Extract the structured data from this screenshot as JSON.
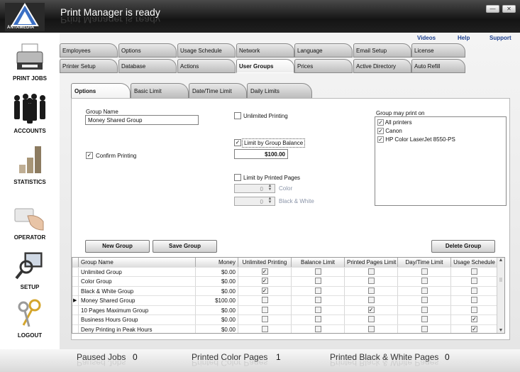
{
  "app": {
    "title": "Print Manager is ready",
    "logo_text": "ANTAMEDIA"
  },
  "window": {
    "minimize": "—",
    "close": "✕"
  },
  "sidebar": [
    {
      "label": "PRINT JOBS",
      "icon": "printer-icon"
    },
    {
      "label": "ACCOUNTS",
      "icon": "people-icon"
    },
    {
      "label": "STATISTICS",
      "icon": "bar-chart-icon"
    },
    {
      "label": "OPERATOR",
      "icon": "card-hand-icon"
    },
    {
      "label": "SETUP",
      "icon": "magnifier-monitor-icon"
    },
    {
      "label": "LOGOUT",
      "icon": "keys-icon"
    }
  ],
  "toplinks": [
    "Videos",
    "Help",
    "Support"
  ],
  "tabs_row1": [
    "Employees",
    "Options",
    "Usage Schedule",
    "Network",
    "Language",
    "Email Setup",
    "License"
  ],
  "tabs_row2": [
    "Printer Setup",
    "Database",
    "Actions",
    "User Groups",
    "Prices",
    "Active Directory",
    "Auto Refill"
  ],
  "active_tab": "User Groups",
  "subtabs": [
    "Options",
    "Basic Limit",
    "Date/Time Limit",
    "Daily Limits"
  ],
  "active_subtab": "Options",
  "form": {
    "group_name_label": "Group Name",
    "group_name_value": "Money Shared Group",
    "confirm_printing_label": "Confirm Printing",
    "confirm_printing_checked": true,
    "unlimited_printing_label": "Unlimited Printing",
    "unlimited_printing_checked": false,
    "limit_balance_label": "Limit by Group Balance",
    "limit_balance_checked": true,
    "balance_value": "$100.00",
    "limit_pages_label": "Limit by Printed Pages",
    "limit_pages_checked": false,
    "color_value": "0",
    "color_label": "Color",
    "bw_value": "0",
    "bw_label": "Black & White",
    "printers_label": "Group may print on",
    "printers": [
      {
        "name": "All printers",
        "checked": true
      },
      {
        "name": "Canon",
        "checked": true
      },
      {
        "name": "HP Color LaserJet 8550-PS",
        "checked": true
      }
    ]
  },
  "buttons": {
    "new_group": "New Group",
    "save_group": "Save Group",
    "delete_group": "Delete Group"
  },
  "grid": {
    "columns": [
      "Group Name",
      "Money",
      "Unlimited Printing",
      "Balance Limit",
      "Printed Pages Limit",
      "Day/Time Limit",
      "Usage Schedule"
    ],
    "rows": [
      {
        "name": "Unlimited Group",
        "money": "$0.00",
        "flags": [
          true,
          false,
          false,
          false,
          false
        ]
      },
      {
        "name": "Color Group",
        "money": "$0.00",
        "flags": [
          true,
          false,
          false,
          false,
          false
        ]
      },
      {
        "name": "Black & White Group",
        "money": "$0.00",
        "flags": [
          true,
          false,
          false,
          false,
          false
        ]
      },
      {
        "name": "Money Shared Group",
        "money": "$100.00",
        "flags": [
          false,
          false,
          false,
          false,
          false
        ],
        "current": true
      },
      {
        "name": "10 Pages Maximum Group",
        "money": "$0.00",
        "flags": [
          false,
          false,
          true,
          false,
          false
        ]
      },
      {
        "name": "Business Hours Group",
        "money": "$0.00",
        "flags": [
          false,
          false,
          false,
          false,
          true
        ]
      },
      {
        "name": "Deny Printing in Peak Hours",
        "money": "$0.00",
        "flags": [
          false,
          false,
          false,
          false,
          true
        ]
      }
    ]
  },
  "footer": {
    "paused_label": "Paused Jobs",
    "paused_value": "0",
    "color_label": "Printed Color Pages",
    "color_value": "1",
    "bw_label": "Printed Black & White Pages",
    "bw_value": "0"
  }
}
